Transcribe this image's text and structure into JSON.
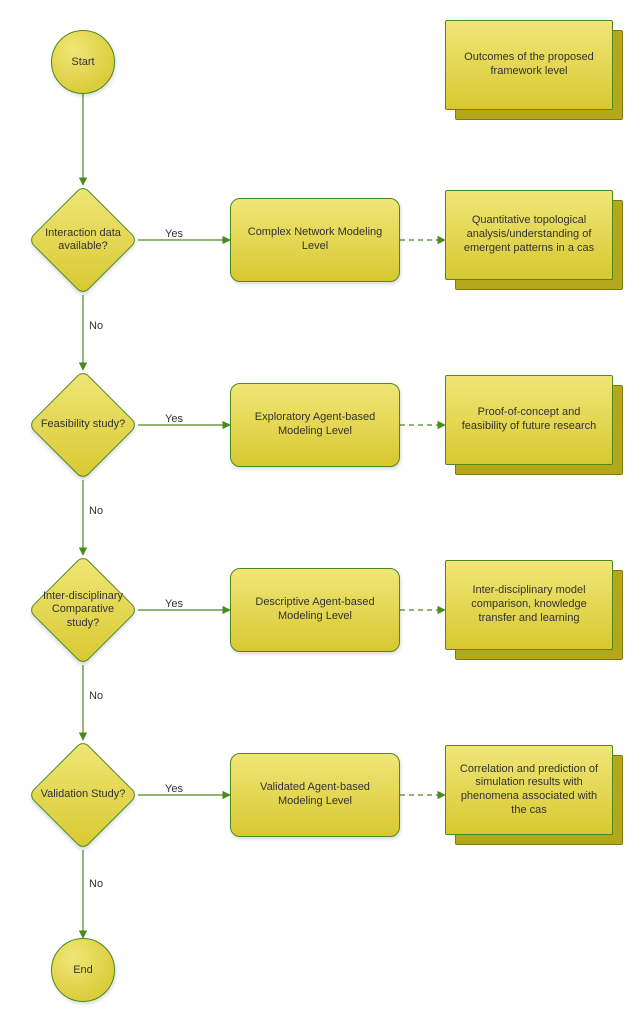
{
  "terminators": {
    "start": "Start",
    "end": "End"
  },
  "decisions": {
    "d1": "Interaction data available?",
    "d2": "Feasibility study?",
    "d3": "Inter-disciplinary Comparative study?",
    "d4": "Validation Study?"
  },
  "processes": {
    "p1": "Complex Network Modeling Level",
    "p2": "Exploratory Agent-based Modeling Level",
    "p3": "Descriptive Agent-based Modeling Level",
    "p4": "Validated Agent-based Modeling Level"
  },
  "outcomes": {
    "header": "Outcomes of the proposed framework level",
    "o1": "Quantitative topological analysis/understanding of emergent patterns in a cas",
    "o2": "Proof-of-concept and feasibility of future research",
    "o3": "Inter-disciplinary model comparison, knowledge transfer and learning",
    "o4": "Correlation and prediction of simulation results with phenomena associated with the cas"
  },
  "edge_labels": {
    "yes": "Yes",
    "no": "No"
  },
  "chart_data": {
    "type": "diagram",
    "diagram_type": "flowchart",
    "nodes": [
      {
        "id": "start",
        "kind": "terminator",
        "label": "Start"
      },
      {
        "id": "d1",
        "kind": "decision",
        "label": "Interaction data available?"
      },
      {
        "id": "p1",
        "kind": "process",
        "label": "Complex Network Modeling Level"
      },
      {
        "id": "o1",
        "kind": "outcome",
        "label": "Quantitative topological analysis/understanding of emergent patterns in a cas"
      },
      {
        "id": "d2",
        "kind": "decision",
        "label": "Feasibility study?"
      },
      {
        "id": "p2",
        "kind": "process",
        "label": "Exploratory Agent-based Modeling Level"
      },
      {
        "id": "o2",
        "kind": "outcome",
        "label": "Proof-of-concept and feasibility of future research"
      },
      {
        "id": "d3",
        "kind": "decision",
        "label": "Inter-disciplinary Comparative study?"
      },
      {
        "id": "p3",
        "kind": "process",
        "label": "Descriptive Agent-based Modeling Level"
      },
      {
        "id": "o3",
        "kind": "outcome",
        "label": "Inter-disciplinary model comparison, knowledge transfer and learning"
      },
      {
        "id": "d4",
        "kind": "decision",
        "label": "Validation Study?"
      },
      {
        "id": "p4",
        "kind": "process",
        "label": "Validated Agent-based Modeling Level"
      },
      {
        "id": "o4",
        "kind": "outcome",
        "label": "Correlation and prediction of simulation results with phenomena associated with the cas"
      },
      {
        "id": "end",
        "kind": "terminator",
        "label": "End"
      },
      {
        "id": "header",
        "kind": "outcome",
        "label": "Outcomes of the proposed framework level"
      }
    ],
    "edges": [
      {
        "from": "start",
        "to": "d1",
        "style": "solid"
      },
      {
        "from": "d1",
        "to": "p1",
        "label": "Yes",
        "style": "solid"
      },
      {
        "from": "p1",
        "to": "o1",
        "style": "dashed"
      },
      {
        "from": "d1",
        "to": "d2",
        "label": "No",
        "style": "solid"
      },
      {
        "from": "d2",
        "to": "p2",
        "label": "Yes",
        "style": "solid"
      },
      {
        "from": "p2",
        "to": "o2",
        "style": "dashed"
      },
      {
        "from": "d2",
        "to": "d3",
        "label": "No",
        "style": "solid"
      },
      {
        "from": "d3",
        "to": "p3",
        "label": "Yes",
        "style": "solid"
      },
      {
        "from": "p3",
        "to": "o3",
        "style": "dashed"
      },
      {
        "from": "d3",
        "to": "d4",
        "label": "No",
        "style": "solid"
      },
      {
        "from": "d4",
        "to": "p4",
        "label": "Yes",
        "style": "solid"
      },
      {
        "from": "p4",
        "to": "o4",
        "style": "dashed"
      },
      {
        "from": "d4",
        "to": "end",
        "label": "No",
        "style": "solid"
      }
    ]
  }
}
